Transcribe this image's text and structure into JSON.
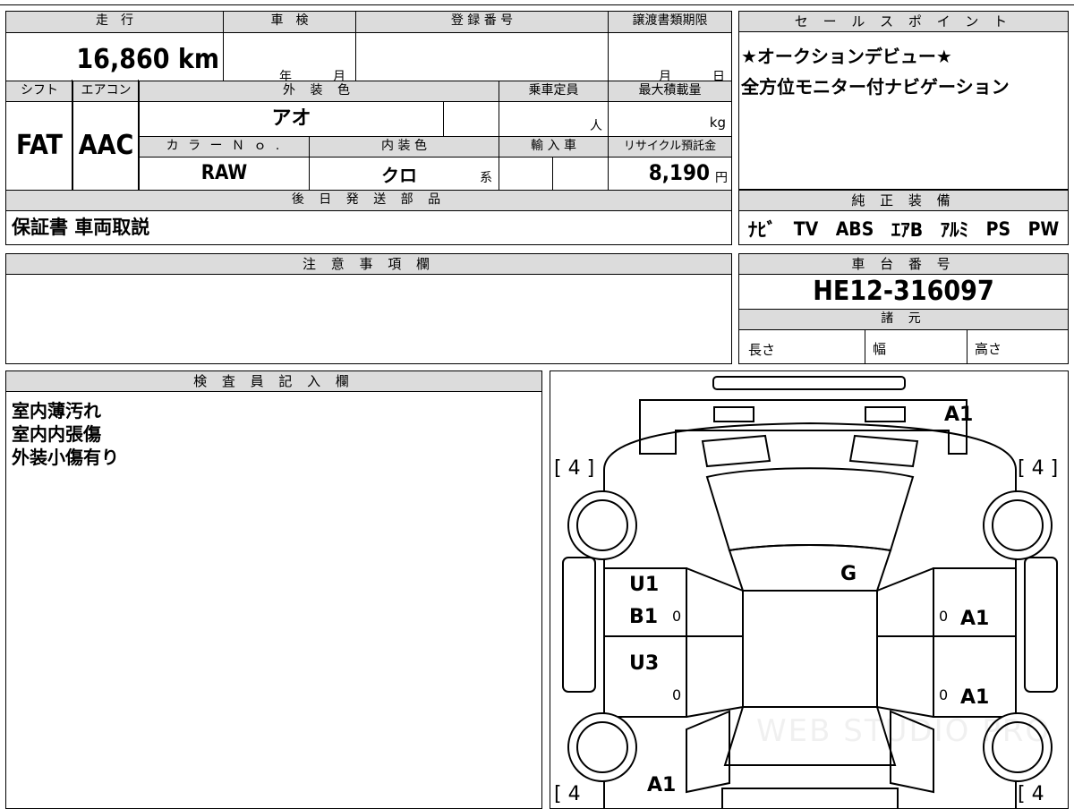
{
  "top": {
    "labels": {
      "mileage": "走　行",
      "inspection": "車　検",
      "registration": "登 録 番 号",
      "transfer_deadline": "譲渡書類期限",
      "shift": "シフト",
      "aircon": "エアコン",
      "exterior_color": "外 装 色",
      "capacity": "乗車定員",
      "max_load": "最大積載量",
      "color_no": "カ ラ ー Ｎ ｏ .",
      "interior_color": "内 装 色",
      "import": "輸 入 車",
      "recycle": "リサイクル預託金",
      "later_parts": "後 日 発 送 部 品"
    },
    "mileage_value": "16,860 km",
    "inspection_year_unit": "年",
    "inspection_month_unit": "月",
    "transfer_month_unit": "月",
    "transfer_day_unit": "日",
    "shift_value": "FAT",
    "aircon_value": "AAC",
    "exterior_color_value": "アオ",
    "capacity_unit": "人",
    "max_load_unit": "kg",
    "color_no_value": "RAW",
    "interior_color_value": "クロ",
    "interior_color_suffix": "系",
    "recycle_value": "8,190",
    "recycle_unit": "円",
    "later_parts_value": "保証書 車両取説"
  },
  "sales_points": {
    "header": "セ ー ル ス ポ イ ン ト",
    "lines": [
      "★オークションデビュー★",
      "全方位モニター付ナビゲーション"
    ]
  },
  "equipment": {
    "header": "純 正 装 備",
    "items": [
      "ﾅﾋﾞ",
      "TV",
      "ABS",
      "ｴｱB",
      "ｱﾙﾐ",
      "PS",
      "PW"
    ]
  },
  "notes": {
    "header": "注 意 事 項 欄"
  },
  "chassis": {
    "header": "車 台 番 号",
    "value": "HE12-316097"
  },
  "specs": {
    "header": "諸 元",
    "length": "長さ",
    "width": "幅",
    "height": "高さ"
  },
  "inspector": {
    "header": "検 査 員 記 入 欄",
    "lines": [
      "室内薄汚れ",
      "室内内張傷",
      "外装小傷有り"
    ]
  },
  "diagram": {
    "tire_front_left": "[ 4 ]",
    "tire_front_right": "[ 4 ]",
    "tire_rear_left": "[ 4",
    "tire_rear_right": "[ 4",
    "front_bumper": "A1",
    "windshield": "G",
    "left_front_door_1": "U1",
    "left_front_door_2": "B1",
    "left_rear_door": "U3",
    "right_front_door": "A1",
    "right_rear_door": "A1",
    "rear_left": "A1",
    "zero": "0",
    "watermark": "WEB STUDIO PRO"
  }
}
